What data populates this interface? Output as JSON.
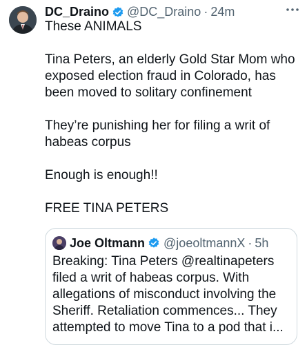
{
  "tweet": {
    "author_name": "DC_Draino",
    "author_handle": "@DC_Draino",
    "separator": "·",
    "timestamp": "24m",
    "paragraphs": [
      "These ANIMALS",
      "Tina Peters, an elderly Gold Star Mom who exposed election fraud in Colorado, has been moved to solitary confinement",
      "They’re punishing her for filing a writ of habeas corpus",
      "Enough is enough!!",
      "FREE TINA PETERS"
    ]
  },
  "quoted": {
    "author_name": "Joe Oltmann",
    "author_handle": "@joeoltmannX",
    "separator": "·",
    "timestamp": "5h",
    "lines": [
      "Breaking: Tina Peters @realtinapeters",
      "filed a writ of habeas corpus. With",
      "allegations of misconduct involving the",
      "Sheriff. Retaliation commences... They",
      "attempted to move Tina to a pod that i..."
    ]
  },
  "icons": {
    "verified": "verified-badge-icon",
    "menu": "more-options-icon"
  },
  "colors": {
    "verified_blue": "#1d9bf0",
    "secondary_text": "#536471",
    "border": "#cfd9de"
  }
}
